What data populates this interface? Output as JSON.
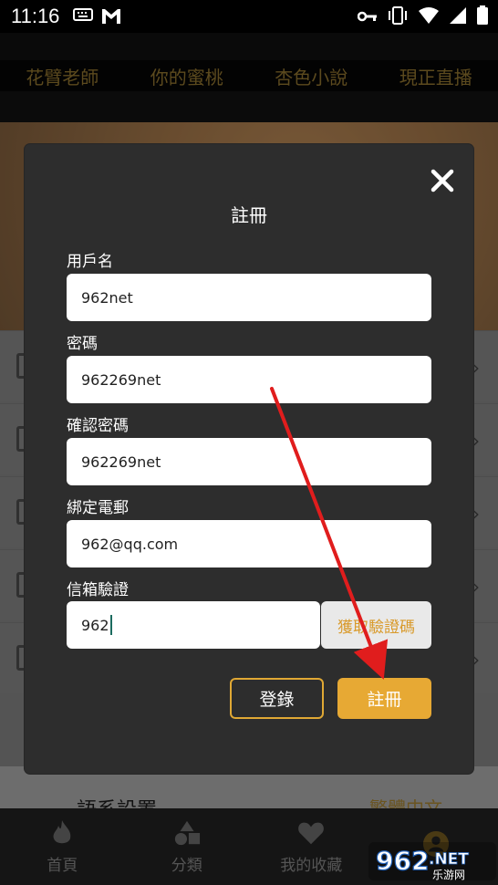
{
  "status_bar": {
    "time": "11:16",
    "left_icons": [
      "keyboard-icon",
      "gmail-icon"
    ],
    "right_icons": [
      "vpn-key-icon",
      "vibrate-icon",
      "wifi-icon",
      "signal-icon",
      "battery-icon"
    ]
  },
  "top_nav": {
    "items": [
      {
        "label": "花臂老師"
      },
      {
        "label": "你的蜜桃"
      },
      {
        "label": "杏色小說"
      },
      {
        "label": "現正直播"
      }
    ]
  },
  "background_menu": {
    "language_label": "語系設置",
    "language_value": "繁體中文"
  },
  "tab_bar": {
    "tabs": [
      {
        "label": "首頁",
        "icon": "flame-icon"
      },
      {
        "label": "分類",
        "icon": "shapes-icon"
      },
      {
        "label": "我的收藏",
        "icon": "heart-icon"
      },
      {
        "label": "",
        "icon": "person-icon"
      }
    ]
  },
  "modal": {
    "title": "註冊",
    "fields": {
      "username": {
        "label": "用戶名",
        "value": "962net"
      },
      "password": {
        "label": "密碼",
        "value": "962269net"
      },
      "confirm_password": {
        "label": "確認密碼",
        "value": "962269net"
      },
      "email": {
        "label": "綁定電郵",
        "value": "962@qq.com"
      },
      "verify": {
        "label": "信箱驗證",
        "value": "962"
      }
    },
    "get_code_label": "獲取驗證碼",
    "login_label": "登錄",
    "register_label": "註冊"
  },
  "watermark": {
    "brand": "962.NET",
    "sub": "乐游网"
  },
  "colors": {
    "accent": "#e7a934",
    "modal_bg": "#2d2d2d",
    "annotation_arrow": "#e01d1d"
  }
}
